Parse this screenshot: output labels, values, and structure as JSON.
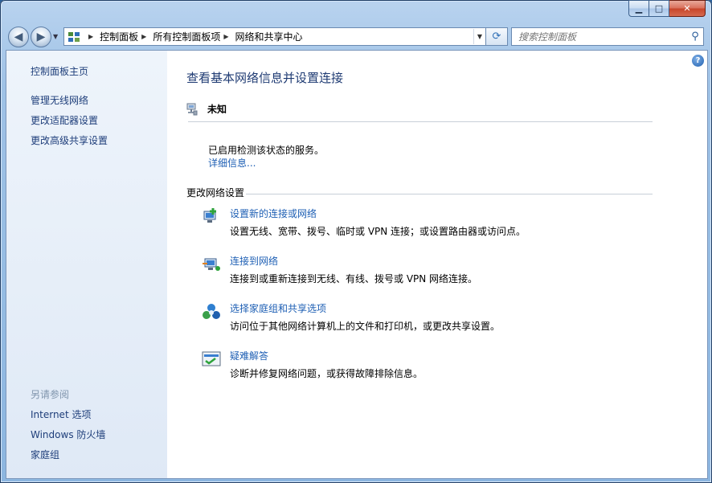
{
  "window": {
    "caption": {
      "minimize": "▁",
      "maximize": "□",
      "close": "✕"
    }
  },
  "address_bar": {
    "crumbs": [
      "控制面板",
      "所有控制面板项",
      "网络和共享中心"
    ]
  },
  "search": {
    "placeholder": "搜索控制面板"
  },
  "sidebar": {
    "home": "控制面板主页",
    "links": [
      "管理无线网络",
      "更改适配器设置",
      "更改高级共享设置"
    ],
    "see_also_header": "另请参阅",
    "see_also": [
      "Internet 选项",
      "Windows 防火墙",
      "家庭组"
    ]
  },
  "main": {
    "title": "查看基本网络信息并设置连接",
    "network_name": "未知",
    "status": "已启用检测该状态的服务。",
    "details_link": "详细信息...",
    "section_title": "更改网络设置",
    "tasks": [
      {
        "link": "设置新的连接或网络",
        "desc": "设置无线、宽带、拨号、临时或 VPN 连接；或设置路由器或访问点。",
        "icon": "new-connection-icon"
      },
      {
        "link": "连接到网络",
        "desc": "连接到或重新连接到无线、有线、拨号或 VPN 网络连接。",
        "icon": "connect-network-icon"
      },
      {
        "link": "选择家庭组和共享选项",
        "desc": "访问位于其他网络计算机上的文件和打印机，或更改共享设置。",
        "icon": "homegroup-icon"
      },
      {
        "link": "疑难解答",
        "desc": "诊断并修复网络问题，或获得故障排除信息。",
        "icon": "troubleshoot-icon"
      }
    ]
  },
  "help": "?"
}
